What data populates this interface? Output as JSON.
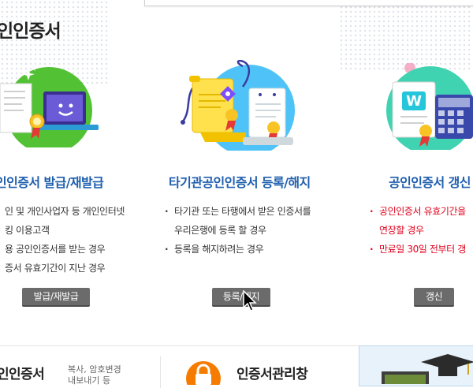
{
  "page_title": "인인증서",
  "cards": [
    {
      "title": "인인증서 발급/재발급",
      "items": [
        "인 및 개인사업자 등 개인인터넷",
        "킹 이용고객",
        "용 공인인증서를 받는 경우",
        "증서 유효기간이 지난 경우"
      ],
      "button": "발급/재발급"
    },
    {
      "title": "타기관공인인증서 등록/해지",
      "items": [
        "타기관 또는 타행에서 받은 인증서를",
        "우리은행에 등록 할 경우",
        "등록을 해지하려는 경우"
      ],
      "button": "등록/해지"
    },
    {
      "title": "공인인증서 갱신",
      "items": [
        "공인인증서 유효기간을",
        "연장할 경우",
        "만료일 30일 전부터 갱"
      ],
      "button": "갱신"
    }
  ],
  "bottom": {
    "left_title": "인인증서",
    "left_sub_line1": "복사, 암호변경",
    "left_sub_line2": "내보내기 등",
    "mid_title": "인증서관리창"
  },
  "colors": {
    "title_blue": "#1f5fae",
    "warn_red": "#e0001b",
    "button_gray": "#6b6b6b",
    "green_circle": "#52c234",
    "sky_circle": "#4fc3f7",
    "teal_circle": "#3fd3b2"
  },
  "icons": {
    "card1": "certificate-laptop-icon",
    "card2": "certificate-scroll-icon",
    "card3": "certificate-calculator-icon",
    "bottom_mid": "lock-icon",
    "cursor": "mouse-pointer-icon"
  }
}
